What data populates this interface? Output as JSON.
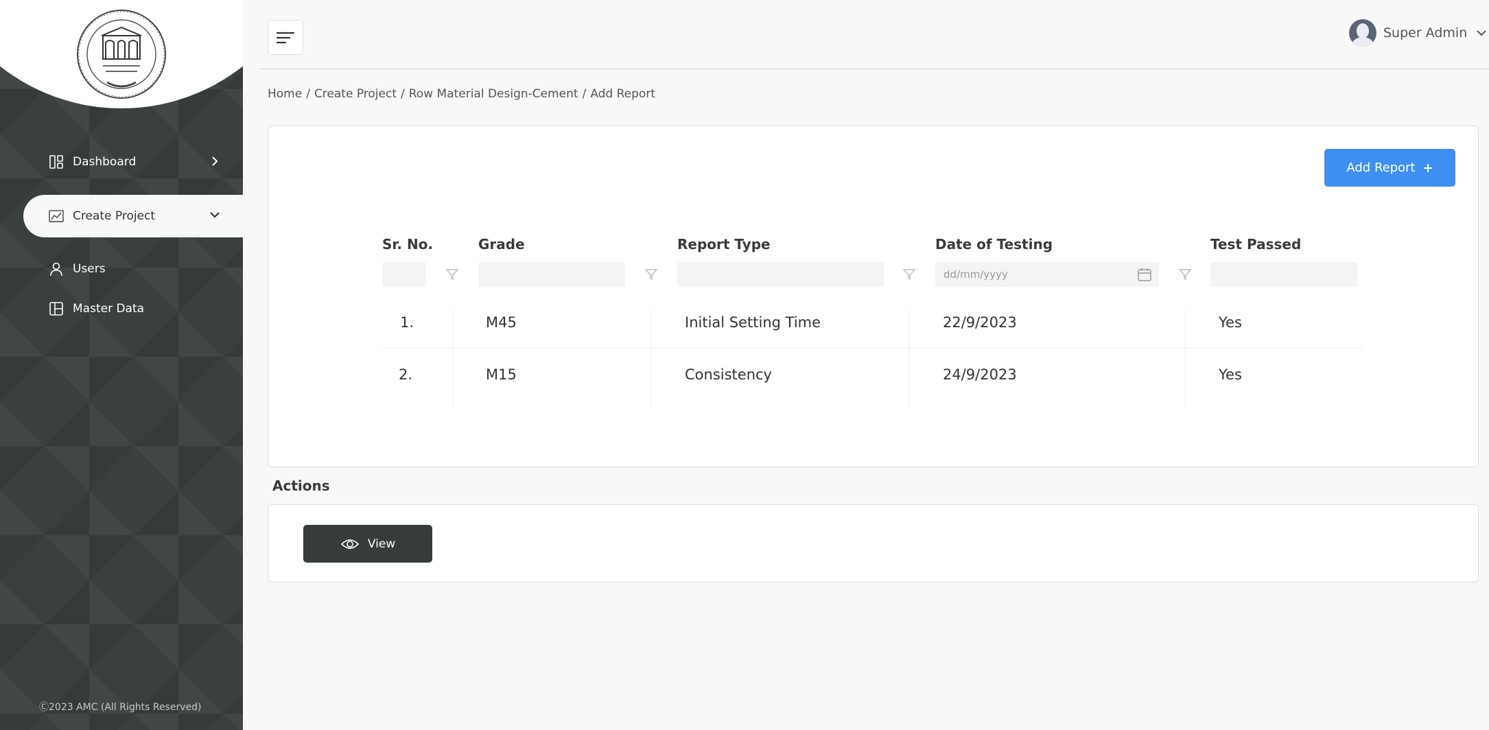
{
  "sidebar": {
    "logo_alt": "AMC emblem",
    "items": [
      {
        "label": "Dashboard",
        "icon": "dashboard-icon"
      },
      {
        "label": "Create Project",
        "icon": "create-project-icon"
      },
      {
        "label": "Users",
        "icon": "user-icon"
      },
      {
        "label": "Master Data",
        "icon": "master-data-icon"
      }
    ],
    "active_item": "Create Project",
    "footer": "2023 AMC (All Rights Reserved)"
  },
  "header": {
    "menu_icon": "hamburger-icon",
    "user_name": "Super Admin"
  },
  "breadcrumb": {
    "items": [
      "Home",
      "/",
      "Create Project",
      "/",
      "Row Material Design-Cement",
      "/",
      "Add Report"
    ]
  },
  "toolbar": {
    "add_report_label": "Add Report"
  },
  "table": {
    "columns": [
      "Sr. No.",
      "Grade",
      "Report Type",
      "Date of Testing",
      "Test Passed"
    ],
    "date_placeholder": "dd/mm/yyyy",
    "rows": [
      {
        "sr": "1.",
        "grade": "M45",
        "report_type": "Initial Setting Time",
        "date": "22/9/2023",
        "passed": "Yes"
      },
      {
        "sr": "2.",
        "grade": "M15",
        "report_type": "Consistency",
        "date": "24/9/2023",
        "passed": "Yes"
      }
    ]
  },
  "actions": {
    "title": "Actions",
    "view_label": "View"
  },
  "colors": {
    "sidebar_bg": "#3a3f40",
    "accent": "#3d8ff0",
    "view_button": "#363b3c"
  }
}
